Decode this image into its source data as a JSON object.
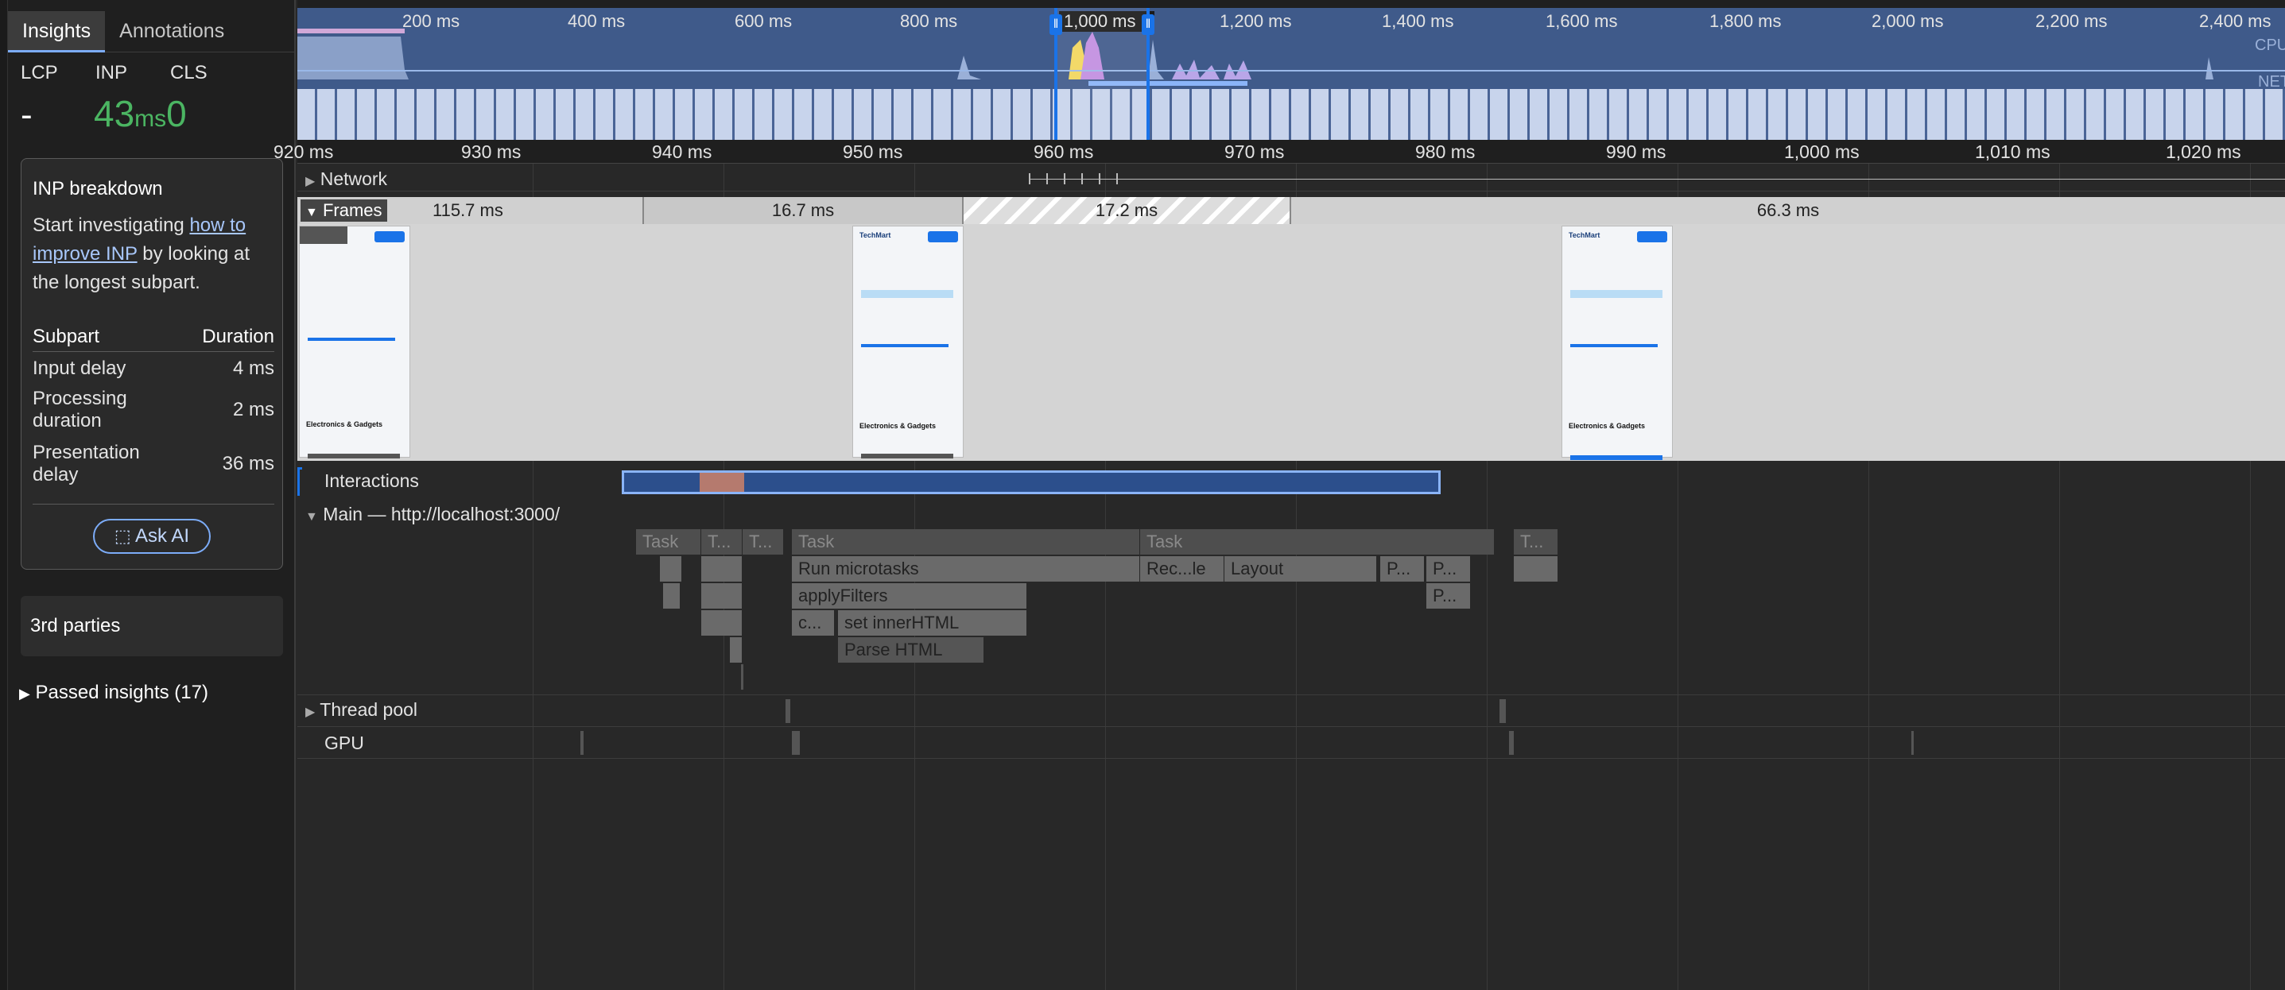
{
  "left": {
    "tabs": [
      "Insights",
      "Annotations"
    ],
    "metrics": {
      "lcp_label": "LCP",
      "lcp_value": "-",
      "inp_label": "INP",
      "inp_value": "43",
      "inp_unit": "ms",
      "cls_label": "CLS",
      "cls_value": "0"
    },
    "breakdown": {
      "title": "INP breakdown",
      "text_before": "Start investigating ",
      "link": "how to improve INP",
      "text_after": " by looking at the longest subpart.",
      "col_subpart": "Subpart",
      "col_duration": "Duration",
      "rows": [
        {
          "name": "Input delay",
          "value": "4 ms"
        },
        {
          "name": "Processing duration",
          "value": "2 ms"
        },
        {
          "name": "Presentation delay",
          "value": "36 ms"
        }
      ],
      "ask_ai": "Ask AI"
    },
    "third_parties": "3rd parties",
    "passed": "Passed insights (17)"
  },
  "overview": {
    "ticks": [
      "200 ms",
      "400 ms",
      "600 ms",
      "800 ms",
      "1,000 ms",
      "1,200 ms",
      "1,400 ms",
      "1,600 ms",
      "1,800 ms",
      "2,000 ms",
      "2,200 ms",
      "2,400 ms"
    ],
    "cpu_label": "CPU",
    "net_label": "NET"
  },
  "ruler": {
    "ticks": [
      "920 ms",
      "930 ms",
      "940 ms",
      "950 ms",
      "960 ms",
      "970 ms",
      "980 ms",
      "990 ms",
      "1,000 ms",
      "1,010 ms",
      "1,020 ms"
    ]
  },
  "tracks": {
    "network": "Network",
    "frames": "Frames",
    "frame_durations": [
      "115.7 ms",
      "16.7 ms",
      "17.2 ms",
      "66.3 ms"
    ],
    "interactions": "Interactions",
    "main": "Main — http://localhost:3000/",
    "thread_pool": "Thread pool",
    "gpu": "GPU"
  },
  "flame": {
    "tasks": [
      "Task",
      "T...",
      "T...",
      "Task",
      "Task",
      "T..."
    ],
    "run_microtasks": "Run microtasks",
    "recalc": "Rec...le",
    "layout": "Layout",
    "p1": "P...",
    "p2": "P...",
    "p3": "P...",
    "apply_filters": "applyFilters",
    "c": "c...",
    "set_inner_html": "set innerHTML",
    "parse_html": "Parse HTML"
  },
  "screenshot": {
    "brand": "TechMart",
    "heading": "Electronics & Gadgets"
  },
  "colors": {
    "accent": "#7cacf8",
    "inp_good": "#4bb562",
    "overview_bg": "#3f5a8a"
  }
}
